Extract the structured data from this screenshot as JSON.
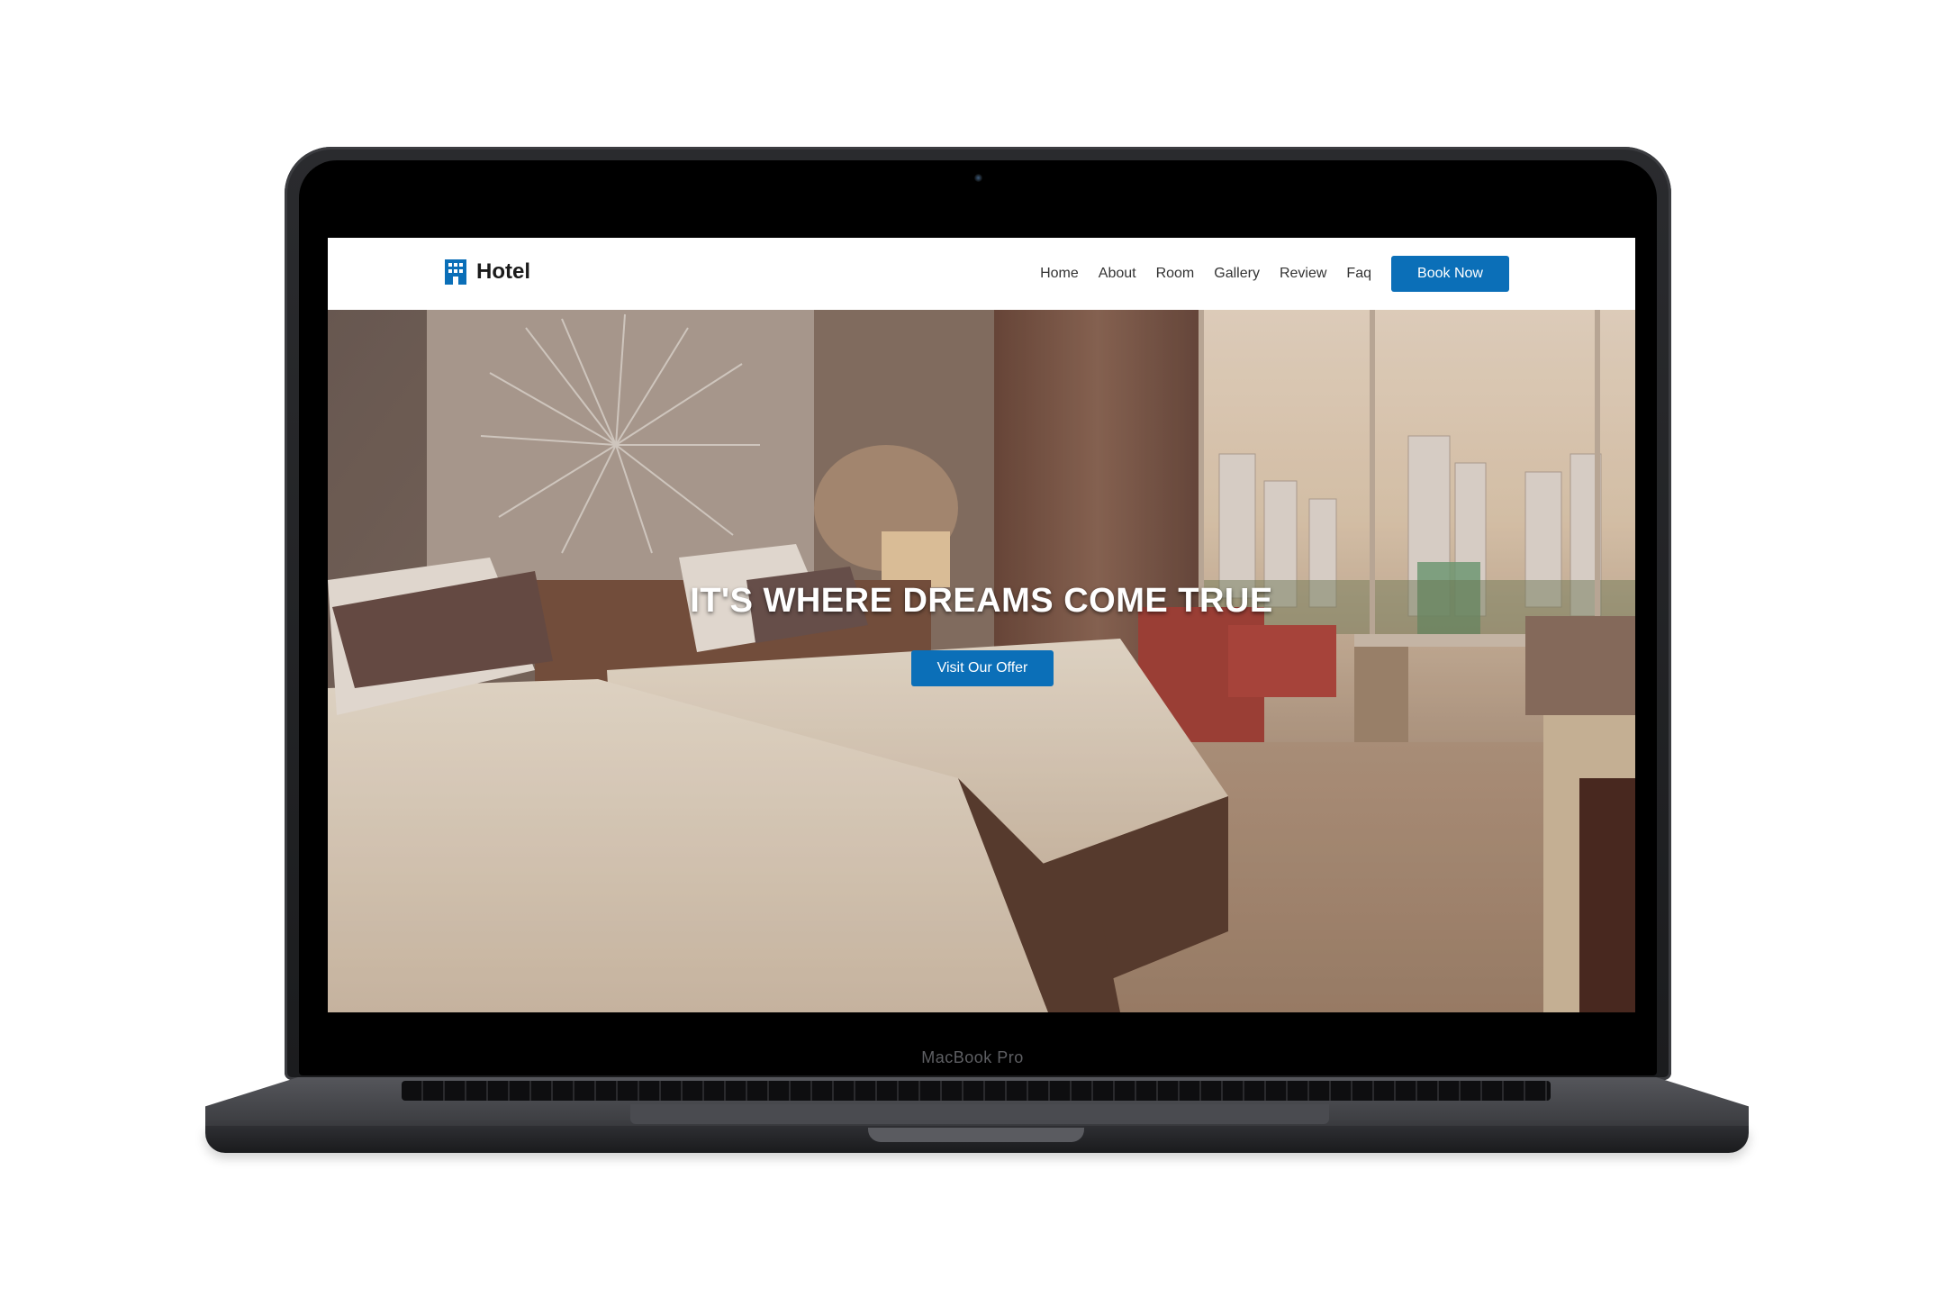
{
  "device": {
    "brand_label": "MacBook Pro"
  },
  "site": {
    "logo_text": "Hotel",
    "logo_icon": "hotel-building-icon",
    "accent_color": "#0b6fb8"
  },
  "nav": {
    "links": [
      {
        "label": "Home"
      },
      {
        "label": "About"
      },
      {
        "label": "Room"
      },
      {
        "label": "Gallery"
      },
      {
        "label": "Review"
      },
      {
        "label": "Faq"
      }
    ],
    "cta_label": "Book Now"
  },
  "hero": {
    "title": "IT'S WHERE DREAMS COME TRUE",
    "button_label": "Visit Our Offer"
  }
}
